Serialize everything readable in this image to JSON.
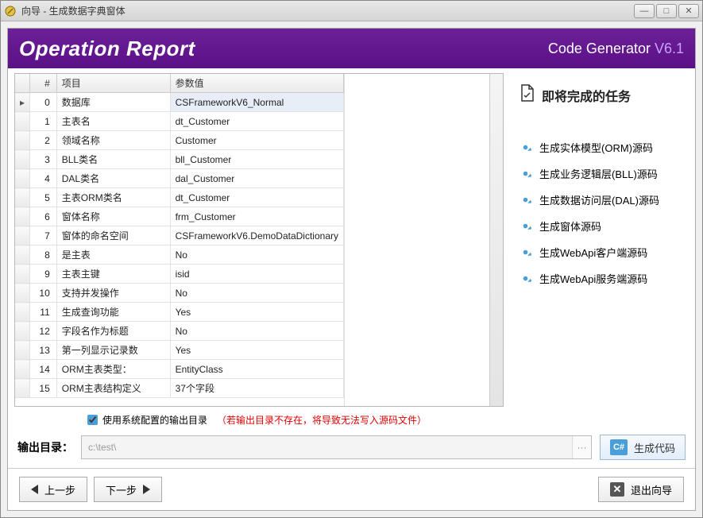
{
  "window": {
    "title": "向导 - 生成数据字典窗体"
  },
  "banner": {
    "title": "Operation Report",
    "product": "Code Generator ",
    "version": "V6.1"
  },
  "grid": {
    "headers": {
      "index": "#",
      "project": "项目",
      "value": "参数值"
    },
    "rows": [
      {
        "i": "0",
        "p": "数据库",
        "v": "CSFrameworkV6_Normal",
        "selected": true
      },
      {
        "i": "1",
        "p": "主表名",
        "v": "dt_Customer"
      },
      {
        "i": "2",
        "p": "领域名称",
        "v": "Customer"
      },
      {
        "i": "3",
        "p": "BLL类名",
        "v": "bll_Customer"
      },
      {
        "i": "4",
        "p": "DAL类名",
        "v": "dal_Customer"
      },
      {
        "i": "5",
        "p": "主表ORM类名",
        "v": "dt_Customer"
      },
      {
        "i": "6",
        "p": "窗体名称",
        "v": "frm_Customer"
      },
      {
        "i": "7",
        "p": "窗体的命名空间",
        "v": "CSFrameworkV6.DemoDataDictionary"
      },
      {
        "i": "8",
        "p": "是主表",
        "v": "No"
      },
      {
        "i": "9",
        "p": "主表主键",
        "v": "isid"
      },
      {
        "i": "10",
        "p": "支持并发操作",
        "v": "No"
      },
      {
        "i": "11",
        "p": "生成查询功能",
        "v": "Yes"
      },
      {
        "i": "12",
        "p": "字段名作为标题",
        "v": "No"
      },
      {
        "i": "13",
        "p": "第一列显示记录数",
        "v": "Yes"
      },
      {
        "i": "14",
        "p": "ORM主表类型：",
        "v": "EntityClass"
      },
      {
        "i": "15",
        "p": "ORM主表结构定义",
        "v": "37个字段"
      }
    ]
  },
  "side": {
    "title": "即将完成的任务",
    "tasks": [
      "生成实体模型(ORM)源码",
      "生成业务逻辑层(BLL)源码",
      "生成数据访问层(DAL)源码",
      "生成窗体源码",
      "生成WebApi客户端源码",
      "生成WebApi服务端源码"
    ]
  },
  "options": {
    "checkbox_label": "使用系统配置的输出目录",
    "warn": "（若输出目录不存在，将导致无法写入源码文件）"
  },
  "output": {
    "label": "输出目录：",
    "placeholder": "c:\\test\\",
    "ellipsis": "···",
    "button": "生成代码"
  },
  "footer": {
    "prev": "上一步",
    "next": "下一步",
    "exit": "退出向导"
  }
}
